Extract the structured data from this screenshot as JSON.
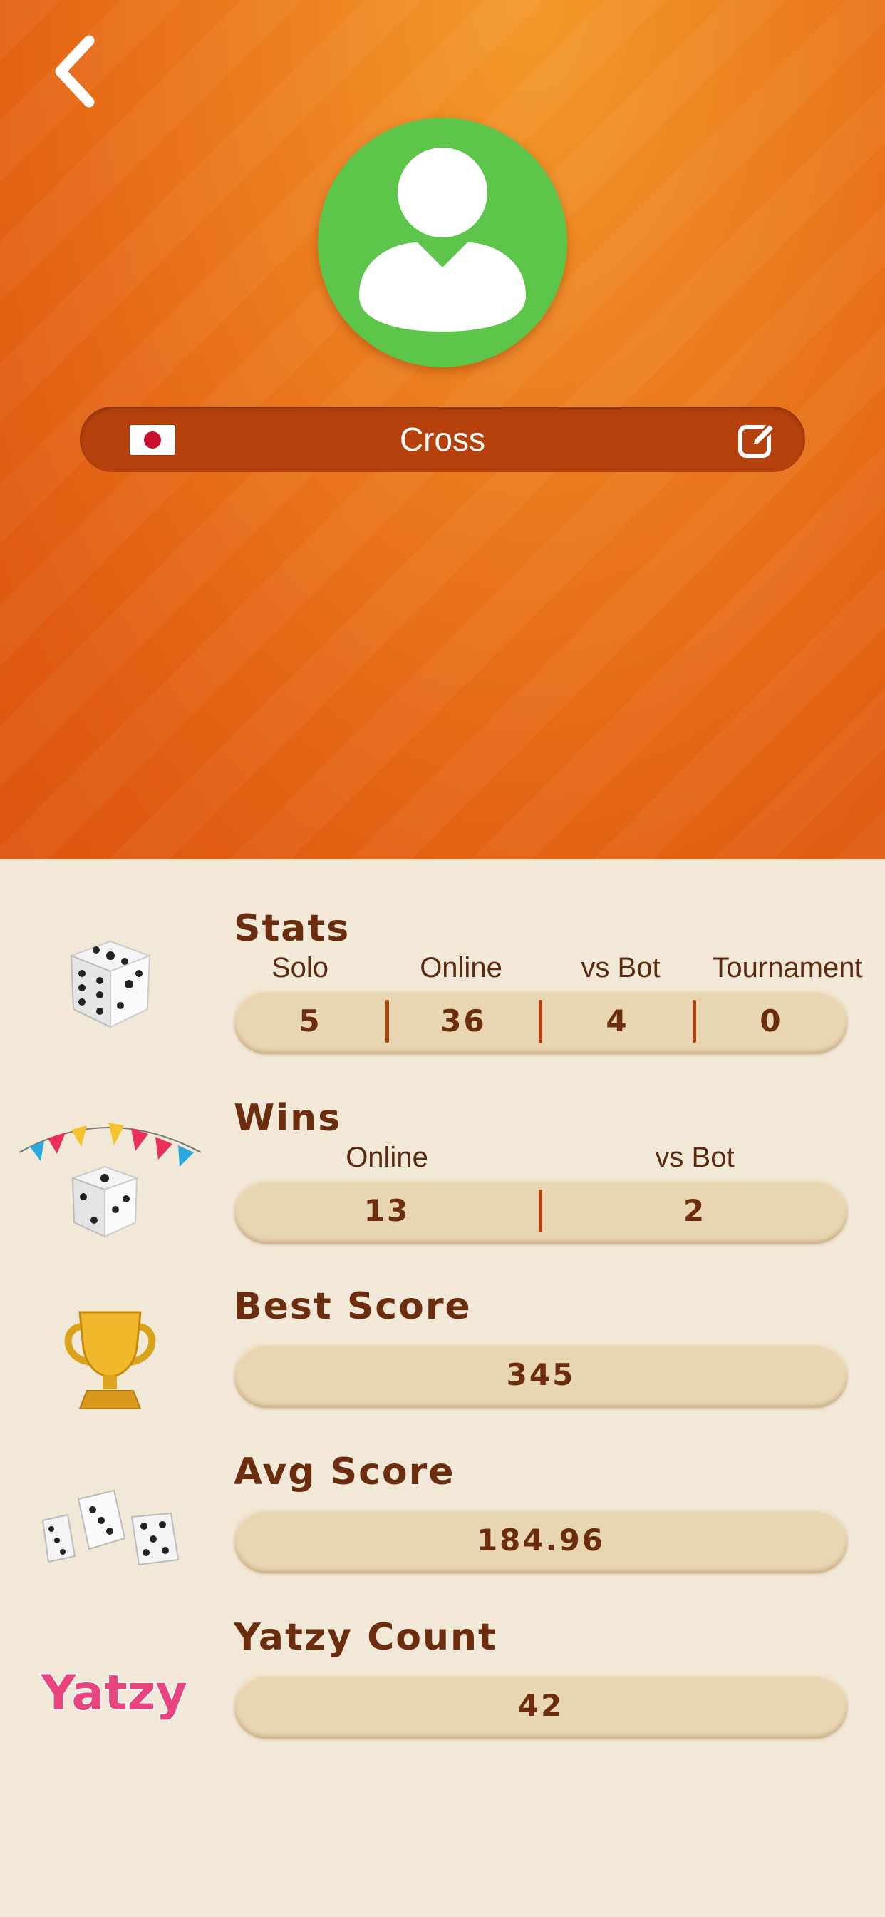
{
  "header": {
    "profile_name": "Cross",
    "flag": "japan-flag",
    "icons": {
      "back": "chevron-left-icon",
      "edit": "edit-icon",
      "avatar": "user-avatar-icon"
    },
    "colors": {
      "avatar_bg": "#5cc54a",
      "name_bar_bg": "#b5410c",
      "header_orange": "#ec7e1e"
    }
  },
  "stats": {
    "title": "Stats",
    "columns": [
      {
        "label": "Solo",
        "value": "5"
      },
      {
        "label": "Online",
        "value": "36"
      },
      {
        "label": "vs Bot",
        "value": "4"
      },
      {
        "label": "Tournament",
        "value": "0"
      }
    ]
  },
  "wins": {
    "title": "Wins",
    "columns": [
      {
        "label": "Online",
        "value": "13"
      },
      {
        "label": "vs Bot",
        "value": "2"
      }
    ]
  },
  "best_score": {
    "title": "Best Score",
    "value": "345"
  },
  "avg_score": {
    "title": "Avg Score",
    "value": "184.96"
  },
  "yatzy_count": {
    "title": "Yatzy Count",
    "value": "42",
    "logo_text": "Yatzy"
  }
}
